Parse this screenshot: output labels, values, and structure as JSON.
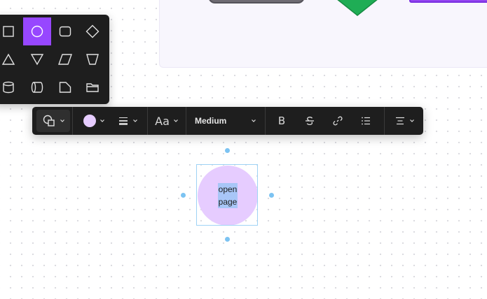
{
  "canvas": {
    "background_color": "#ffffff",
    "dot_color": "#d9d9de"
  },
  "frame": {
    "background_color": "#f8f6fd",
    "nodes": [
      {
        "name": "gray-rounded-node",
        "color": "#6f6c73"
      },
      {
        "name": "green-diamond-node",
        "color": "#1fad55"
      },
      {
        "name": "purple-rect-node",
        "color": "#9546f0"
      }
    ]
  },
  "shape_picker": {
    "selected": "ellipse",
    "accent_color": "#9747ff",
    "shapes": [
      "square",
      "ellipse",
      "rounded-rectangle",
      "diamond",
      "triangle",
      "triangle-down",
      "parallelogram",
      "trapezoid",
      "cylinder",
      "horizontal-cylinder",
      "document",
      "folder"
    ]
  },
  "toolbar": {
    "shape_button_icon": "shapes-icon",
    "fill_color": "#e6ccff",
    "stroke_icon": "stroke-weight-icon",
    "font_label": "Aa",
    "font_weight_label": "Medium",
    "bold_label": "B",
    "strikethrough_icon": "strikethrough-icon",
    "link_icon": "link-icon",
    "list_icon": "list-icon",
    "align_icon": "align-center-icon"
  },
  "shape_node": {
    "text_line_1": "open",
    "text_line_2": "page",
    "fill_color": "#e6ccff",
    "selection_color": "#9fd3f5"
  }
}
